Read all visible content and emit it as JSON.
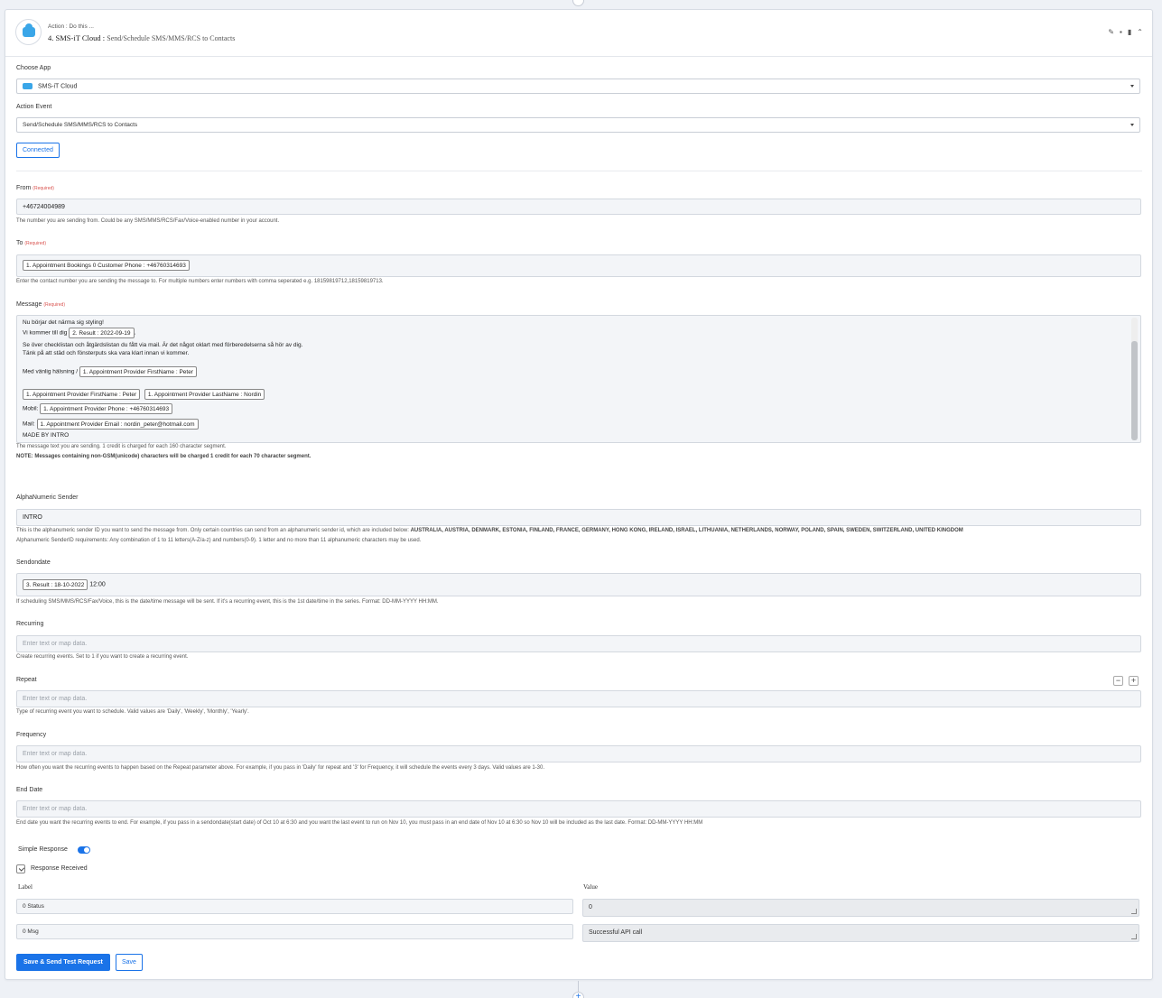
{
  "header": {
    "sub": "Action : Do this ...",
    "title_app": "4. SMS-iT Cloud",
    "title_sep": " : ",
    "title_event": "Send/Schedule SMS/MMS/RCS to Contacts"
  },
  "choose_app": {
    "label": "Choose App",
    "value": "SMS-iT Cloud"
  },
  "action_event": {
    "label": "Action Event",
    "value": "Send/Schedule SMS/MMS/RCS to Contacts"
  },
  "connected_label": "Connected",
  "required_tag": "(Required)",
  "from": {
    "label": "From",
    "value": "+46724004989",
    "help": "The number you are sending from. Could be any SMS/MMS/RCS/Fax/Voice-enabled number in your account."
  },
  "to": {
    "label": "To",
    "pill": "1. Appointment Bookings 0 Customer Phone : +46760314693",
    "help": "Enter the contact number you are sending the message to. For multiple numbers enter numbers with comma seperated e.g. 18159819712,18159819713."
  },
  "message": {
    "label": "Message",
    "line1": "Nu börjar det närma sig styling!",
    "line2_prefix": "Vi kommer till dig",
    "line2_pill": "2. Result : 2022-09-19",
    "line2_suffix": ".",
    "line3": "Se över checklistan och åtgärdslistan du fått via mail. Är det något oklart med förberedelserna så hör av dig.",
    "line4": "Tänk på att städ och fönsterputs ska vara klart innan vi kommer.",
    "line5_prefix": "Med vänlig hälsning /",
    "line5_pill": "1. Appointment Provider FirstName : Peter",
    "line6_pill1": "1. Appointment Provider FirstName : Peter",
    "line6_pill2": "1. Appointment Provider LastName : Nordin",
    "line7_prefix": "Mobil:",
    "line7_pill": "1. Appointment Provider Phone : +46760314693",
    "line8_prefix": "Mail:",
    "line8_pill": "1. Appointment Provider Email : nordin_peter@hotmail.com",
    "line9": "MADE BY INTRO",
    "help1": "The message text you are sending. 1 credit is charged for each 160 character segment.",
    "help2": "NOTE: Messages containing non-GSM(unicode) characters will be charged 1 credit for each 70 character segment."
  },
  "alpha": {
    "label": "AlphaNumeric Sender",
    "value": "INTRO",
    "help1_prefix": "This is the alphanumeric sender ID you want to send the message from. Only certain countries can send from an alphanumeric sender id, which are included below: ",
    "help1_countries": "AUSTRALIA, AUSTRIA, DENMARK, ESTONIA, FINLAND, FRANCE, GERMANY, HONG KONG, IRELAND, ISRAEL, LITHUANIA, NETHERLANDS, NORWAY, POLAND, SPAIN, SWEDEN, SWITZERLAND, UNITED KINGDOM",
    "help2": "Alphanumeric SenderID requirements: Any combination of 1 to 11 letters(A-Z/a-z) and numbers(0-9). 1 letter and no more than 11 alphanumeric characters may be used."
  },
  "sendondate": {
    "label": "Sendondate",
    "pill": "3. Result : 18-10-2022",
    "suffix": "12:00",
    "help": "If scheduling SMS/MMS/RCS/Fax/Voice, this is the date/time message will be sent. If it's a recurring event, this is the 1st date/time in the series. Format: DD-MM-YYYY HH:MM."
  },
  "placeholder": "Enter text or map data.",
  "recurring": {
    "label": "Recurring",
    "help": "Create recurring events. Set to 1 if you want to create a recurring event."
  },
  "repeat": {
    "label": "Repeat",
    "help": "Type of recurring event you want to schedule. Valid values are 'Daily', 'Weekly', 'Monthly', 'Yearly'.",
    "minus": "−",
    "plus": "+"
  },
  "frequency": {
    "label": "Frequency",
    "help": "How often you want the recurring events to happen based on the Repeat parameter above. For example, if you pass in 'Daily' for repeat and '3' for Frequency, it will schedule the events every 3 days. Valid values are 1-30."
  },
  "end_date": {
    "label": "End Date",
    "help": "End date you want the recurring events to end. For example, if you pass in a sendondate(start date) of Oct 10 at 6:30 and you want the last event to run on Nov 10, you must pass in an end date of Nov 10 at 6:30 so Nov 10 will be included as the last date. Format: DD-MM-YYYY HH:MM"
  },
  "simple_response": {
    "label": "Simple Response",
    "enabled": true
  },
  "response_received": {
    "label": "Response Received",
    "col_label": "Label",
    "col_value": "Value",
    "rows": [
      {
        "label": "0 Status",
        "value": "0"
      },
      {
        "label": "0 Msg",
        "value": "Successful API call"
      }
    ]
  },
  "buttons": {
    "save_send": "Save & Send Test Request",
    "save": "Save"
  },
  "colors": {
    "accent": "#1a73e8",
    "required": "#d9534f"
  }
}
